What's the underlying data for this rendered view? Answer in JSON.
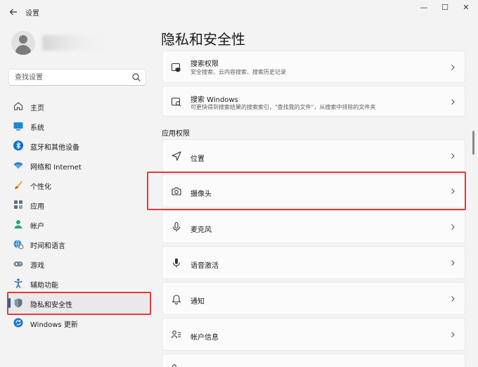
{
  "window": {
    "title": "设置",
    "back_icon": "arrow-left-icon",
    "minimize_symbol": "—",
    "maximize_symbol": "☐",
    "close_symbol": "✕"
  },
  "search": {
    "placeholder": "查找设置",
    "icon": "search-icon"
  },
  "sidebar": {
    "items": [
      {
        "label": "主页",
        "icon": "home-icon",
        "active": false
      },
      {
        "label": "系统",
        "icon": "monitor-icon",
        "active": false
      },
      {
        "label": "蓝牙和其他设备",
        "icon": "bluetooth-icon",
        "active": false
      },
      {
        "label": "网络和 Internet",
        "icon": "wifi-icon",
        "active": false
      },
      {
        "label": "个性化",
        "icon": "brush-icon",
        "active": false
      },
      {
        "label": "应用",
        "icon": "apps-icon",
        "active": false
      },
      {
        "label": "帐户",
        "icon": "person-icon",
        "active": false
      },
      {
        "label": "时间和语言",
        "icon": "globe-clock-icon",
        "active": false
      },
      {
        "label": "游戏",
        "icon": "gamepad-icon",
        "active": false
      },
      {
        "label": "辅助功能",
        "icon": "accessibility-icon",
        "active": false
      },
      {
        "label": "隐私和安全性",
        "icon": "shield-icon",
        "active": true
      },
      {
        "label": "Windows 更新",
        "icon": "update-icon",
        "active": false
      }
    ]
  },
  "main": {
    "title": "隐私和安全性",
    "top_cards": [
      {
        "title": "搜索权限",
        "subtitle": "安全搜索、云内容搜索、搜索历史记录",
        "icon": "search-shield-icon"
      },
      {
        "title": "搜索 Windows",
        "subtitle": "可更快得到搜索结果的搜索索引，\"查找我的文件\"，从搜索中排除的文件夹",
        "icon": "search-window-icon"
      }
    ],
    "section_label": "应用权限",
    "permissions": [
      {
        "title": "位置",
        "icon": "location-arrow-icon"
      },
      {
        "title": "摄像头",
        "icon": "camera-icon"
      },
      {
        "title": "麦克风",
        "icon": "microphone-icon"
      },
      {
        "title": "语音激活",
        "icon": "voice-mic-icon"
      },
      {
        "title": "通知",
        "icon": "bell-icon"
      },
      {
        "title": "帐户信息",
        "icon": "account-info-icon"
      }
    ]
  },
  "colors": {
    "accent": "#005fb8",
    "highlight": "#e53935",
    "background": "#f3f3f3",
    "card": "#fbfbfb"
  }
}
